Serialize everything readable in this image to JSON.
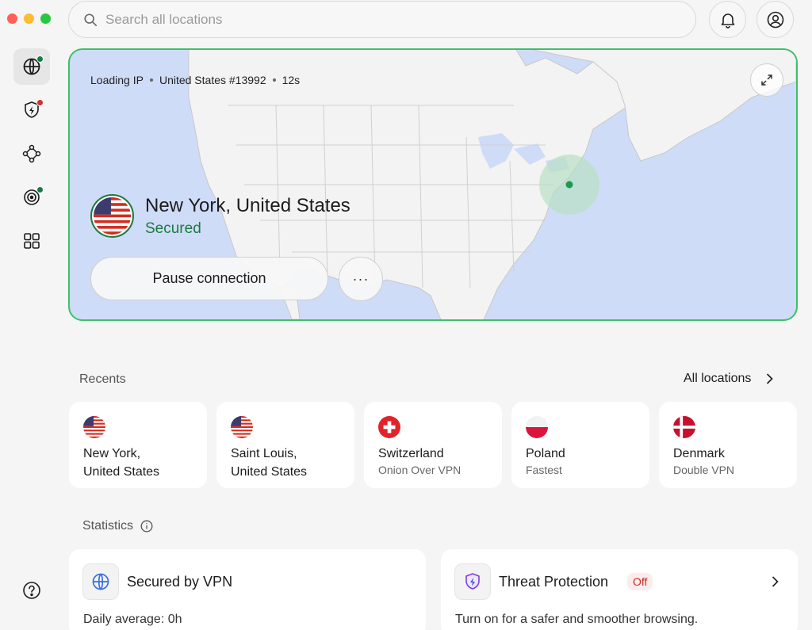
{
  "search": {
    "placeholder": "Search all locations"
  },
  "map": {
    "meta_status": "Loading IP",
    "meta_server": "United States #13992",
    "meta_time": "12s"
  },
  "connection": {
    "location": "New York, United States",
    "status": "Secured",
    "pause_label": "Pause connection",
    "more_label": "···"
  },
  "recents": {
    "label": "Recents",
    "all_label": "All locations",
    "items": [
      {
        "title_line1": "New York,",
        "title_line2": "United States",
        "flag": "us-flag-icon"
      },
      {
        "title_line1": "Saint Louis,",
        "title_line2": "United States",
        "flag": "us-flag-icon"
      },
      {
        "title_line1": "Switzerland",
        "sub": "Onion Over VPN",
        "flag": "ch-flag-icon"
      },
      {
        "title_line1": "Poland",
        "sub": "Fastest",
        "flag": "pl-flag-icon"
      },
      {
        "title_line1": "Denmark",
        "sub": "Double VPN",
        "flag": "dk-flag-icon"
      }
    ]
  },
  "statistics": {
    "label": "Statistics",
    "vpn": {
      "title": "Secured by VPN",
      "sub": "Daily average: 0h"
    },
    "threat": {
      "title": "Threat Protection",
      "badge": "Off",
      "sub": "Turn on for a safer and smoother browsing."
    }
  },
  "colors": {
    "accent_green": "#1a7a3f",
    "border_green": "#3fbf6a",
    "map_water": "#cfdcf7",
    "alert_red": "#c62828"
  }
}
